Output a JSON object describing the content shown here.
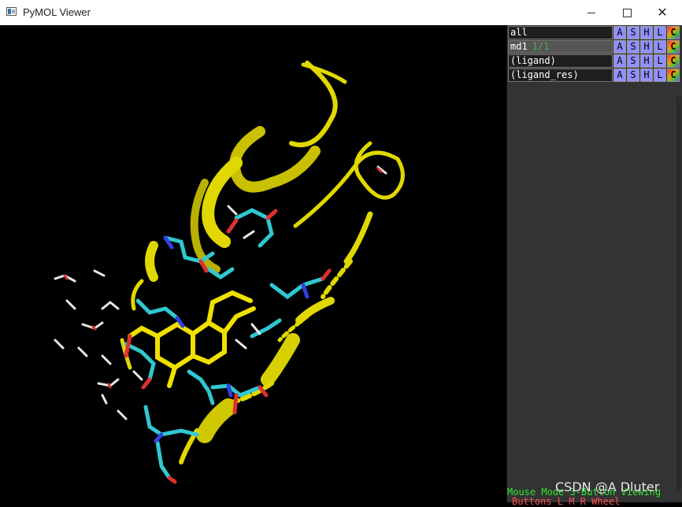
{
  "window": {
    "title": "PyMOL Viewer",
    "icon": "pymol-app-icon",
    "controls": {
      "minimize": "minimize",
      "maximize": "maximize",
      "close": "✕"
    }
  },
  "objects": [
    {
      "name": "all",
      "state": "",
      "enabled": false,
      "buttons": [
        "A",
        "S",
        "H",
        "L",
        "C"
      ]
    },
    {
      "name": "md1",
      "state": "1/1",
      "enabled": true,
      "buttons": [
        "A",
        "S",
        "H",
        "L",
        "C"
      ]
    },
    {
      "name": "(ligand)",
      "state": "",
      "enabled": false,
      "buttons": [
        "A",
        "S",
        "H",
        "L",
        "C"
      ]
    },
    {
      "name": "(ligand_res)",
      "state": "",
      "enabled": false,
      "buttons": [
        "A",
        "S",
        "H",
        "L",
        "C"
      ]
    }
  ],
  "status": {
    "mouse_mode": "Mouse Mode 3-Button Viewing",
    "buttons_line": "Buttons  L    M    R  Wheel"
  },
  "watermark": "CSDN @A Dluter",
  "colors": {
    "background": "#000000",
    "cartoon": "#e0d800",
    "carbon": "#30c8d0",
    "oxygen": "#e03030",
    "nitrogen": "#3040e0",
    "hydrogen": "#e8e8e8",
    "ligand": "#f0e000"
  }
}
